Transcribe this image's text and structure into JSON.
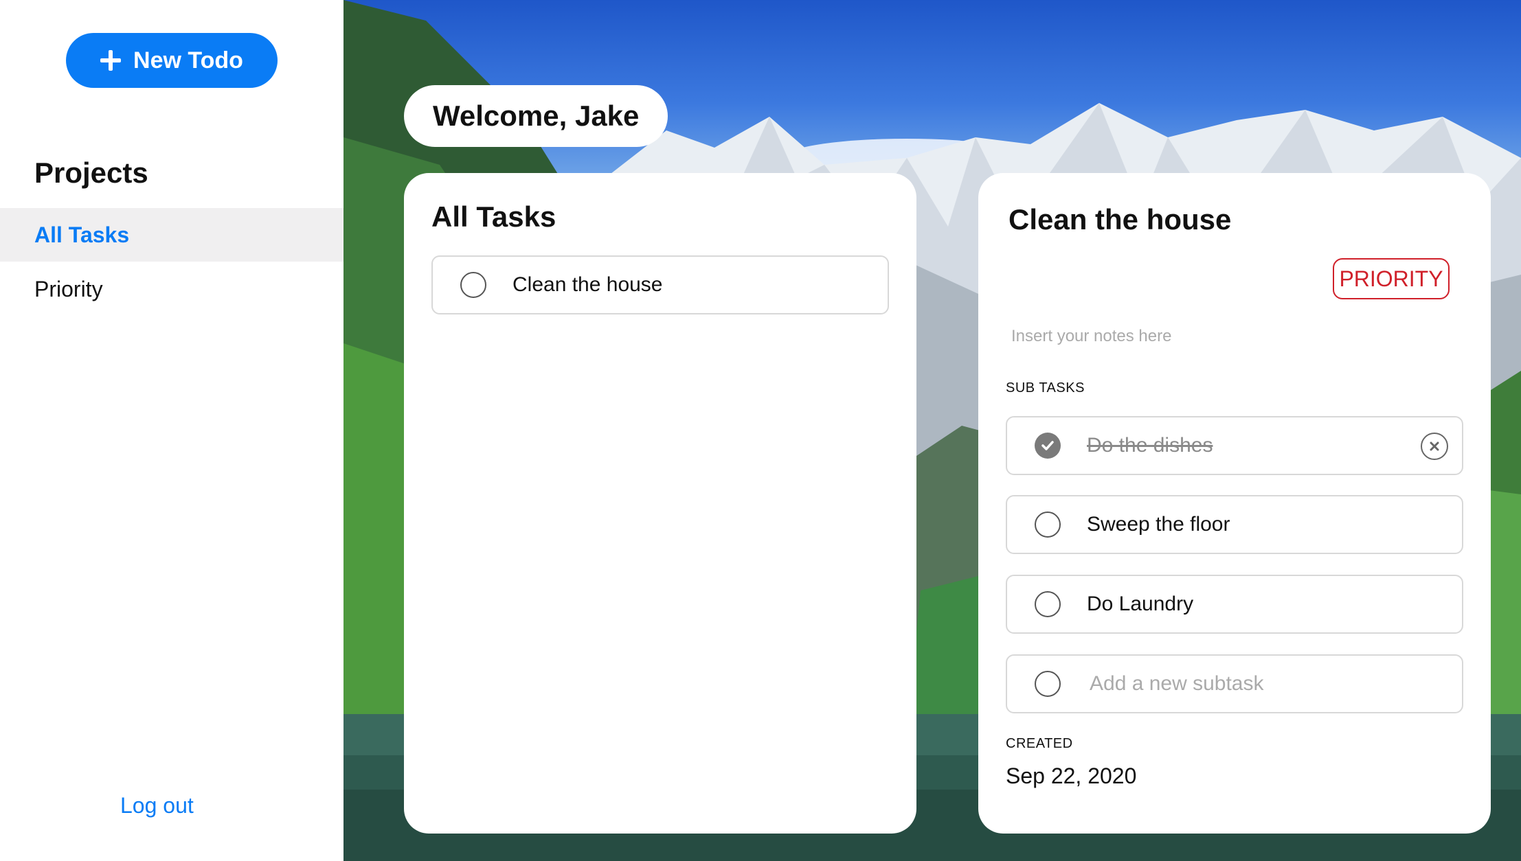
{
  "sidebar": {
    "new_todo_label": "New Todo",
    "projects_heading": "Projects",
    "items": [
      {
        "label": "All Tasks",
        "active": true
      },
      {
        "label": "Priority",
        "active": false
      }
    ],
    "logout_label": "Log out"
  },
  "welcome": "Welcome, Jake",
  "tasks_panel": {
    "title": "All Tasks",
    "tasks": [
      {
        "label": "Clean the house",
        "done": false
      }
    ]
  },
  "detail_panel": {
    "title": "Clean the house",
    "priority_label": "PRIORITY",
    "notes_placeholder": "Insert your notes here",
    "subtasks_heading": "SUB TASKS",
    "subtasks": [
      {
        "label": "Do the dishes",
        "done": true
      },
      {
        "label": "Sweep the floor",
        "done": false
      },
      {
        "label": "Do Laundry",
        "done": false
      }
    ],
    "new_subtask_placeholder": "Add a new subtask",
    "created_heading": "CREATED",
    "created_date": "Sep 22, 2020"
  },
  "colors": {
    "accent": "#0a7cf5",
    "priority": "#d0202a"
  }
}
